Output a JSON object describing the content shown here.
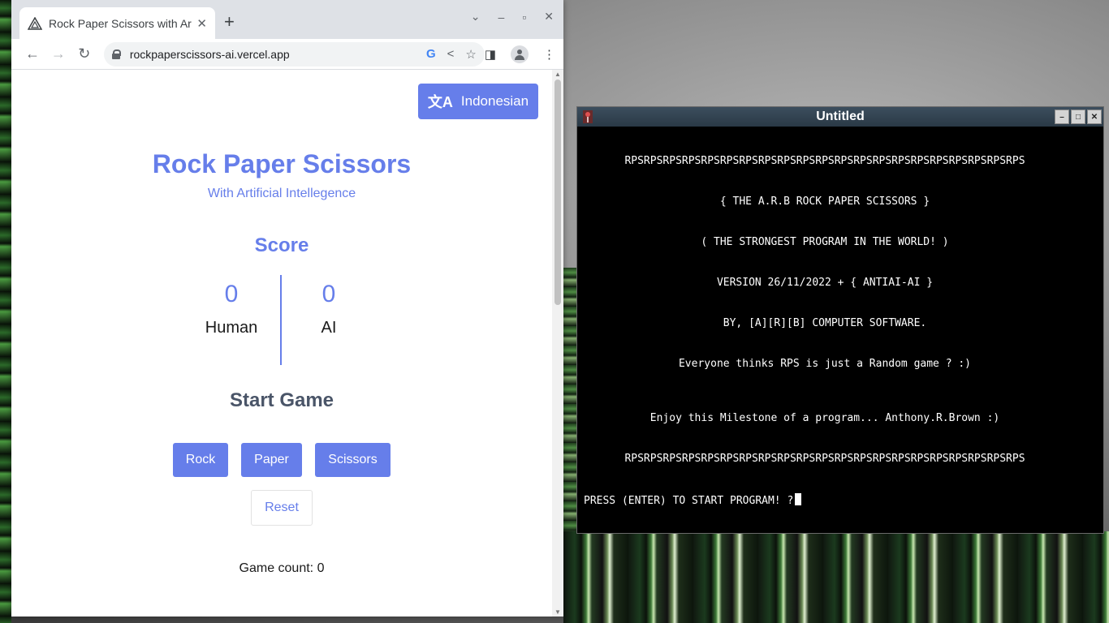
{
  "browser": {
    "tab_title": "Rock Paper Scissors with Artificial Intellegence",
    "url": "rockpaperscissors-ai.vercel.app"
  },
  "app": {
    "language_button": "Indonesian",
    "title": "Rock Paper Scissors",
    "subtitle": "With Artificial Intellegence",
    "score_title": "Score",
    "human_score": "0",
    "human_label": "Human",
    "ai_score": "0",
    "ai_label": "AI",
    "start_title": "Start Game",
    "moves": [
      "Rock",
      "Paper",
      "Scissors"
    ],
    "reset_label": "Reset",
    "game_count": "Game count: 0"
  },
  "terminal": {
    "title": "Untitled",
    "lines": [
      "RPSRPSRPSRPSRPSRPSRPSRPSRPSRPSRPSRPSRPSRPSRPSRPSRPSRPSRPSRPSRPS",
      "{ THE A.R.B ROCK PAPER SCISSORS }",
      "( THE STRONGEST PROGRAM IN THE WORLD! )",
      "VERSION 26/11/2022 + { ANTIAI-AI }",
      "BY, [A][R][B] COMPUTER SOFTWARE.",
      "Everyone thinks RPS is just a Random game ? :)",
      "Enjoy this Milestone of a program... Anthony.R.Brown :)",
      "RPSRPSRPSRPSRPSRPSRPSRPSRPSRPSRPSRPSRPSRPSRPSRPSRPSRPSRPSRPSRPS"
    ],
    "prompt": "PRESS (ENTER) TO START PROGRAM! ?"
  }
}
